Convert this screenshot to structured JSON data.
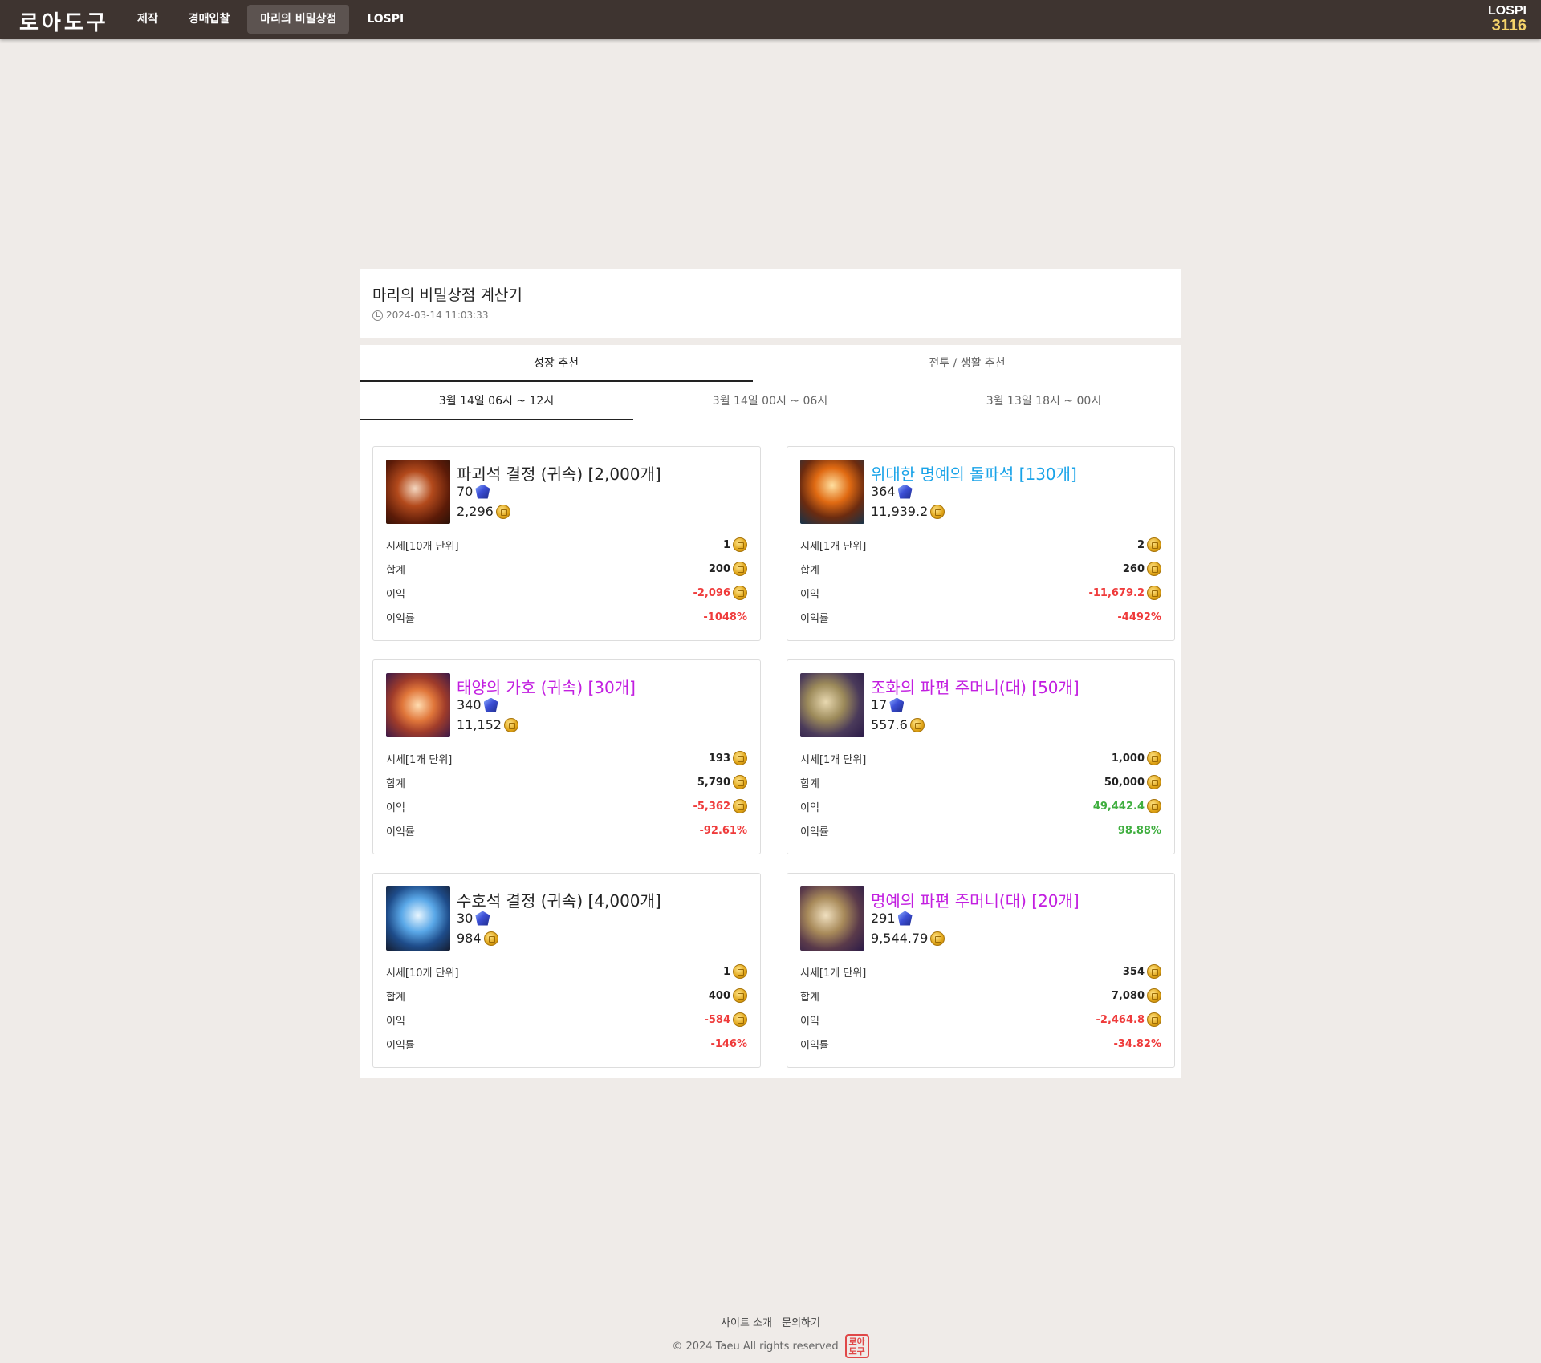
{
  "header": {
    "logo": "로아도구",
    "nav": [
      {
        "label": "제작",
        "active": false
      },
      {
        "label": "경매입찰",
        "active": false
      },
      {
        "label": "마리의 비밀상점",
        "active": true
      },
      {
        "label": "LOSPI",
        "active": false
      }
    ],
    "lospi_label": "LOSPI",
    "lospi_value": "3116"
  },
  "title_panel": {
    "title": "마리의 비밀상점 계산기",
    "updated": "2024-03-14 11:03:33"
  },
  "tabs": [
    "성장 추천",
    "전투 / 생활 추천"
  ],
  "subtabs": [
    "3월 14일 06시 ~ 12시",
    "3월 14일 00시 ~ 06시",
    "3월 13일 18시 ~ 00시"
  ],
  "stat_labels": {
    "market": "시세",
    "total": "합계",
    "profit": "이익",
    "rate": "이익률"
  },
  "cards": [
    {
      "name": "파괴석 결정 (귀속) [2,000개]",
      "name_color": "#222222",
      "icon": "destruction-crystal-icon",
      "crystal": "70",
      "gold": "2,296",
      "market_unit": "시세[10개 단위]",
      "market": "1",
      "total": "200",
      "profit": "-2,096",
      "rate": "-1048%",
      "sign": "neg"
    },
    {
      "name": "위대한 명예의 돌파석 [130개]",
      "name_color": "#1aa3e8",
      "icon": "honor-leapstone-icon",
      "crystal": "364",
      "gold": "11,939.2",
      "market_unit": "시세[1개 단위]",
      "market": "2",
      "total": "260",
      "profit": "-11,679.2",
      "rate": "-4492%",
      "sign": "neg"
    },
    {
      "name": "태양의 가호 (귀속) [30개]",
      "name_color": "#c21ee0",
      "icon": "solar-protection-icon",
      "crystal": "340",
      "gold": "11,152",
      "market_unit": "시세[1개 단위]",
      "market": "193",
      "total": "5,790",
      "profit": "-5,362",
      "rate": "-92.61%",
      "sign": "neg"
    },
    {
      "name": "조화의 파편 주머니(대) [50개]",
      "name_color": "#c21ee0",
      "icon": "harmony-shard-pouch-icon",
      "crystal": "17",
      "gold": "557.6",
      "market_unit": "시세[1개 단위]",
      "market": "1,000",
      "total": "50,000",
      "profit": "49,442.4",
      "rate": "98.88%",
      "sign": "pos"
    },
    {
      "name": "수호석 결정 (귀속) [4,000개]",
      "name_color": "#222222",
      "icon": "guardian-crystal-icon",
      "crystal": "30",
      "gold": "984",
      "market_unit": "시세[10개 단위]",
      "market": "1",
      "total": "400",
      "profit": "-584",
      "rate": "-146%",
      "sign": "neg"
    },
    {
      "name": "명예의 파편 주머니(대) [20개]",
      "name_color": "#c21ee0",
      "icon": "honor-shard-pouch-icon",
      "crystal": "291",
      "gold": "9,544.79",
      "market_unit": "시세[1개 단위]",
      "market": "354",
      "total": "7,080",
      "profit": "-2,464.8",
      "rate": "-34.82%",
      "sign": "neg"
    }
  ],
  "footer": {
    "links": [
      "사이트 소개",
      "문의하기"
    ],
    "copyright": "© 2024 Taeu All rights reserved",
    "stamp": "로아도구"
  },
  "colors": {
    "topbar": "#3e3430",
    "accent_gold": "#f5d36a",
    "negative": "#ef3b3b",
    "positive": "#3fae3f",
    "epic_purple": "#c21ee0",
    "rare_blue": "#1aa3e8"
  }
}
